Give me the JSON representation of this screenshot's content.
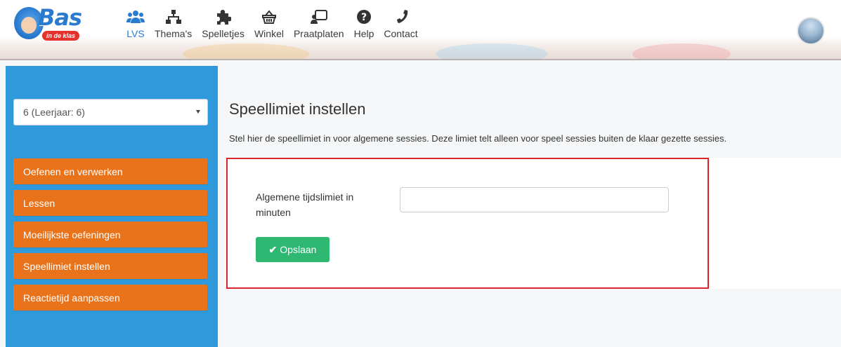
{
  "header": {
    "logo_text": "Bas",
    "logo_tag": "in de klas",
    "nav": [
      {
        "label": "LVS",
        "icon": "users-icon",
        "active": true
      },
      {
        "label": "Thema's",
        "icon": "sitemap-icon",
        "active": false
      },
      {
        "label": "Spelletjes",
        "icon": "puzzle-icon",
        "active": false
      },
      {
        "label": "Winkel",
        "icon": "basket-icon",
        "active": false
      },
      {
        "label": "Praatplaten",
        "icon": "chat-board-icon",
        "active": false
      },
      {
        "label": "Help",
        "icon": "question-icon",
        "active": false
      },
      {
        "label": "Contact",
        "icon": "phone-icon",
        "active": false
      }
    ],
    "accent_color": "#2a7bd0"
  },
  "sidebar": {
    "group_select": {
      "value": "6 (Leerjaar: 6)"
    },
    "items": [
      {
        "label": "Oefenen en verwerken"
      },
      {
        "label": "Lessen"
      },
      {
        "label": "Moeilijkste oefeningen"
      },
      {
        "label": "Speellimiet instellen"
      },
      {
        "label": "Reactietijd aanpassen"
      }
    ],
    "background_color": "#2e9adb",
    "item_color": "#e8731a"
  },
  "main": {
    "title": "Speellimiet instellen",
    "description": "Stel hier de speellimiet in voor algemene sessies. Deze limiet telt alleen voor speel sessies buiten de klaar gezette sessies.",
    "form": {
      "label": "Algemene tijdslimiet in minuten",
      "value": "",
      "placeholder": "",
      "save_label": "Opslaan"
    },
    "save_color": "#2eb872",
    "highlight_color": "#d9262a"
  }
}
